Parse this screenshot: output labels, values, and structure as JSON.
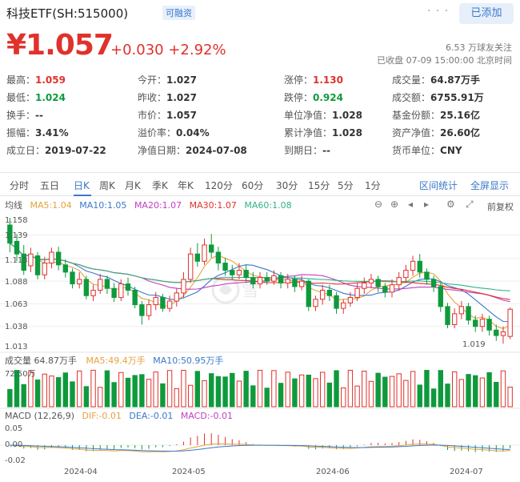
{
  "header": {
    "title": "科技ETF(SH:515000)",
    "badge": "可融资",
    "more": "· · ·",
    "added_label": "已添加",
    "price": "¥1.057",
    "change": "+0.030 +2.92%",
    "followers": "6.53 万球友关注",
    "status": "已收盘 07-09 15:00:00 北京时间"
  },
  "quote": {
    "rows": [
      [
        {
          "label": "最高：",
          "value": "1.059",
          "color": "red"
        },
        {
          "label": "今开：",
          "value": "1.027",
          "color": "normal"
        },
        {
          "label": "涨停：",
          "value": "1.130",
          "color": "red"
        },
        {
          "label": "成交量：",
          "value": "64.87万手",
          "color": "normal"
        }
      ],
      [
        {
          "label": "最低：",
          "value": "1.024",
          "color": "green"
        },
        {
          "label": "昨收：",
          "value": "1.027",
          "color": "normal"
        },
        {
          "label": "跌停：",
          "value": "0.924",
          "color": "green"
        },
        {
          "label": "成交额：",
          "value": "6755.91万",
          "color": "normal"
        }
      ],
      [
        {
          "label": "换手：",
          "value": "--",
          "color": "normal"
        },
        {
          "label": "市价：",
          "value": "1.057",
          "color": "normal"
        },
        {
          "label": "单位净值：",
          "value": "1.028",
          "color": "normal"
        },
        {
          "label": "基金份额：",
          "value": "25.16亿",
          "color": "normal"
        }
      ],
      [
        {
          "label": "振幅：",
          "value": "3.41%",
          "color": "normal"
        },
        {
          "label": "溢价率：",
          "value": "0.04%",
          "color": "normal"
        },
        {
          "label": "累计净值：",
          "value": "1.028",
          "color": "normal"
        },
        {
          "label": "资产净值：",
          "value": "26.60亿",
          "color": "normal"
        }
      ],
      [
        {
          "label": "成立日：",
          "value": "2019-07-22",
          "color": "normal"
        },
        {
          "label": "净值日期：",
          "value": "2024-07-08",
          "color": "normal"
        },
        {
          "label": "到期日：",
          "value": "--",
          "color": "normal"
        },
        {
          "label": "货币单位：",
          "value": "CNY",
          "color": "normal"
        }
      ]
    ]
  },
  "tabs": [
    "分时",
    "五日",
    "日K",
    "周K",
    "月K",
    "季K",
    "年K",
    "120分",
    "60分",
    "30分",
    "15分",
    "5分",
    "1分"
  ],
  "active_tab": "日K",
  "tab_links": {
    "interval_stats": "区间统计",
    "fullscreen": "全屏显示"
  },
  "ma_legend": {
    "label": "均线",
    "ma5": "MA5:1.04",
    "ma10": "MA10:1.05",
    "ma20": "MA20:1.07",
    "ma30": "MA30:1.07",
    "ma60": "MA60:1.08"
  },
  "adjust": "前复权",
  "y_labels": [
    "1.158",
    "1.139",
    "1.113",
    "1.088",
    "1.063",
    "1.038",
    "1.013"
  ],
  "min_marker": "1.019",
  "volume_legend": {
    "vol": "成交量 64.87万手",
    "ma5": "MA5:49.4万手",
    "ma10": "MA10:50.95万手",
    "top": "72.50万"
  },
  "macd_legend": {
    "name": "MACD (12,26,9)",
    "dif": "DIF:-0.01",
    "dea": "DEA:-0.01",
    "macd": "MACD:-0.01"
  },
  "macd_y": [
    "0.05",
    "0.00",
    "-0.02"
  ],
  "x_labels": [
    "2024-04",
    "2024-05",
    "2024-06",
    "2024-07"
  ],
  "colors": {
    "up": "#e0312c",
    "down": "#0e9a3c",
    "accent": "#3a78c9",
    "ma5": "#e6a23c",
    "ma10": "#3a78c9",
    "ma20": "#c23ec2",
    "ma30": "#e0312c",
    "ma60": "#2fb38a"
  },
  "chart_data": {
    "type": "candlestick",
    "note_y_range": [
      1.013,
      1.158
    ],
    "candles": [
      [
        1.15,
        1.13,
        1.158,
        1.12
      ],
      [
        1.132,
        1.118,
        1.14,
        1.11
      ],
      [
        1.118,
        1.1,
        1.128,
        1.095
      ],
      [
        1.105,
        1.118,
        1.125,
        1.098
      ],
      [
        1.116,
        1.095,
        1.12,
        1.09
      ],
      [
        1.095,
        1.108,
        1.115,
        1.09
      ],
      [
        1.108,
        1.12,
        1.125,
        1.102
      ],
      [
        1.12,
        1.106,
        1.126,
        1.1
      ],
      [
        1.106,
        1.098,
        1.112,
        1.092
      ],
      [
        1.098,
        1.085,
        1.102,
        1.08
      ],
      [
        1.085,
        1.09,
        1.098,
        1.08
      ],
      [
        1.09,
        1.072,
        1.094,
        1.068
      ],
      [
        1.072,
        1.078,
        1.084,
        1.066
      ],
      [
        1.078,
        1.09,
        1.096,
        1.074
      ],
      [
        1.09,
        1.08,
        1.094,
        1.074
      ],
      [
        1.08,
        1.07,
        1.086,
        1.065
      ],
      [
        1.07,
        1.085,
        1.09,
        1.066
      ],
      [
        1.085,
        1.078,
        1.092,
        1.072
      ],
      [
        1.078,
        1.062,
        1.082,
        1.058
      ],
      [
        1.062,
        1.05,
        1.066,
        1.04
      ],
      [
        1.05,
        1.062,
        1.068,
        1.045
      ],
      [
        1.062,
        1.07,
        1.076,
        1.056
      ],
      [
        1.07,
        1.058,
        1.074,
        1.054
      ],
      [
        1.058,
        1.066,
        1.072,
        1.054
      ],
      [
        1.066,
        1.075,
        1.08,
        1.06
      ],
      [
        1.075,
        1.09,
        1.098,
        1.07
      ],
      [
        1.09,
        1.118,
        1.125,
        1.086
      ],
      [
        1.118,
        1.11,
        1.13,
        1.104
      ],
      [
        1.11,
        1.128,
        1.135,
        1.106
      ],
      [
        1.128,
        1.12,
        1.14,
        1.114
      ],
      [
        1.12,
        1.108,
        1.126,
        1.1
      ],
      [
        1.108,
        1.1,
        1.114,
        1.094
      ],
      [
        1.1,
        1.095,
        1.106,
        1.09
      ],
      [
        1.095,
        1.1,
        1.108,
        1.09
      ],
      [
        1.1,
        1.092,
        1.106,
        1.086
      ],
      [
        1.092,
        1.085,
        1.098,
        1.08
      ],
      [
        1.085,
        1.092,
        1.098,
        1.08
      ],
      [
        1.092,
        1.088,
        1.098,
        1.084
      ],
      [
        1.088,
        1.094,
        1.1,
        1.084
      ],
      [
        1.094,
        1.086,
        1.098,
        1.08
      ],
      [
        1.086,
        1.09,
        1.096,
        1.08
      ],
      [
        1.09,
        1.082,
        1.094,
        1.076
      ],
      [
        1.082,
        1.088,
        1.094,
        1.078
      ],
      [
        1.088,
        1.06,
        1.09,
        1.055
      ],
      [
        1.06,
        1.068,
        1.072,
        1.055
      ],
      [
        1.068,
        1.078,
        1.084,
        1.062
      ],
      [
        1.078,
        1.072,
        1.084,
        1.066
      ],
      [
        1.072,
        1.058,
        1.076,
        1.052
      ],
      [
        1.058,
        1.064,
        1.068,
        1.052
      ],
      [
        1.064,
        1.07,
        1.076,
        1.06
      ],
      [
        1.07,
        1.08,
        1.086,
        1.066
      ],
      [
        1.08,
        1.086,
        1.092,
        1.074
      ],
      [
        1.086,
        1.09,
        1.096,
        1.08
      ],
      [
        1.09,
        1.082,
        1.094,
        1.076
      ],
      [
        1.082,
        1.076,
        1.086,
        1.07
      ],
      [
        1.076,
        1.084,
        1.09,
        1.07
      ],
      [
        1.084,
        1.092,
        1.098,
        1.078
      ],
      [
        1.092,
        1.1,
        1.106,
        1.086
      ],
      [
        1.1,
        1.11,
        1.116,
        1.094
      ],
      [
        1.11,
        1.098,
        1.118,
        1.092
      ],
      [
        1.098,
        1.09,
        1.102,
        1.084
      ],
      [
        1.09,
        1.082,
        1.094,
        1.076
      ],
      [
        1.082,
        1.06,
        1.086,
        1.054
      ],
      [
        1.06,
        1.04,
        1.064,
        1.036
      ],
      [
        1.04,
        1.052,
        1.058,
        1.036
      ],
      [
        1.052,
        1.06,
        1.066,
        1.046
      ],
      [
        1.06,
        1.045,
        1.064,
        1.04
      ],
      [
        1.045,
        1.038,
        1.05,
        1.032
      ],
      [
        1.038,
        1.046,
        1.052,
        1.032
      ],
      [
        1.046,
        1.034,
        1.05,
        1.028
      ],
      [
        1.034,
        1.028,
        1.04,
        1.022
      ],
      [
        1.028,
        1.032,
        1.038,
        1.019
      ],
      [
        1.027,
        1.057,
        1.059,
        1.024
      ]
    ]
  }
}
